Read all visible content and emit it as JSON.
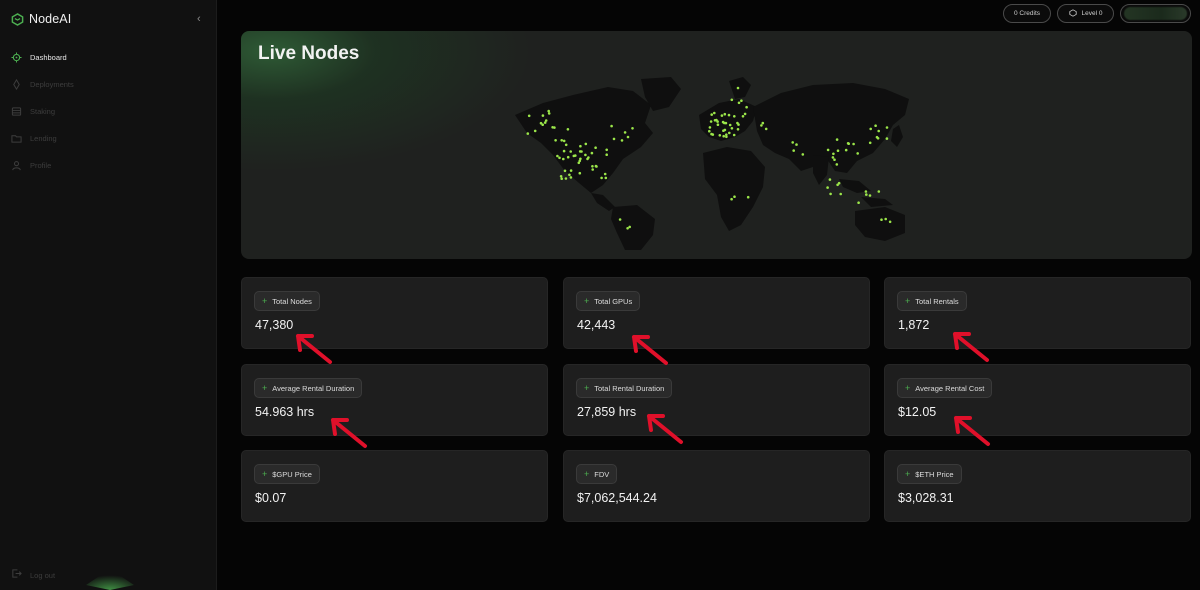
{
  "brand": {
    "name": "NodeAI",
    "accent": "#4caf50"
  },
  "sidebar": {
    "collapse_icon": "chevron-left-icon",
    "items": [
      {
        "label": "Dashboard",
        "icon": "dashboard-icon",
        "active": true
      },
      {
        "label": "Deployments",
        "icon": "rocket-icon",
        "active": false
      },
      {
        "label": "Staking",
        "icon": "stack-icon",
        "active": false
      },
      {
        "label": "Lending",
        "icon": "folder-icon",
        "active": false
      },
      {
        "label": "Profile",
        "icon": "user-icon",
        "active": false
      }
    ],
    "logout_label": "Log out"
  },
  "topbar": {
    "credits_label": "0 Credits",
    "level_label": "Level 0"
  },
  "map": {
    "title": "Live Nodes",
    "node_color": "#9be64a"
  },
  "stats": [
    {
      "label": "Total Nodes",
      "value": "47,380"
    },
    {
      "label": "Total GPUs",
      "value": "42,443"
    },
    {
      "label": "Total Rentals",
      "value": "1,872"
    },
    {
      "label": "Average Rental Duration",
      "value": "54.963 hrs"
    },
    {
      "label": "Total Rental Duration",
      "value": "27,859 hrs"
    },
    {
      "label": "Average Rental Cost",
      "value": "$12.05"
    },
    {
      "label": "$GPU Price",
      "value": "$0.07"
    },
    {
      "label": "FDV",
      "value": "$7,062,544.24"
    },
    {
      "label": "$ETH Price",
      "value": "$3,028.31"
    }
  ],
  "annotation_color": "#e0102a"
}
